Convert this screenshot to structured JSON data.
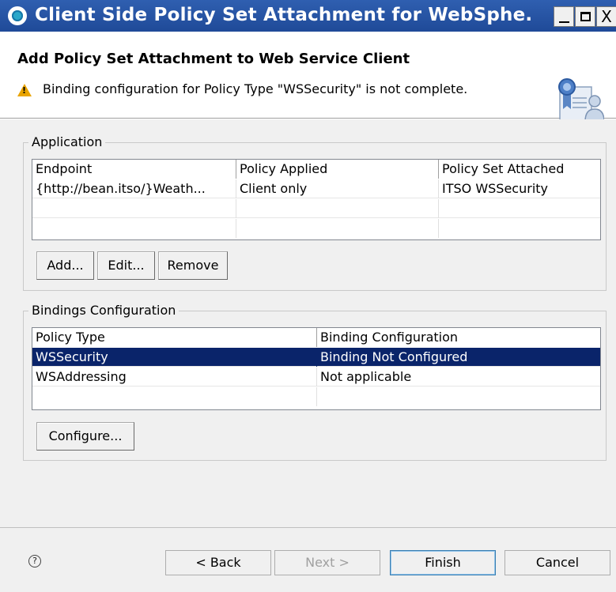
{
  "window": {
    "title": "Client Side Policy Set Attachment for WebSphe...",
    "title_icon": "websphere-globe-icon",
    "minimize_label": "_",
    "maximize_label": "",
    "close_label": "X"
  },
  "header": {
    "title": "Add Policy Set Attachment to Web Service Client",
    "message": "Binding configuration for Policy Type \"WSSecurity\" is not complete.",
    "warning_icon": "warning-triangle-icon",
    "banner_icon": "certificate-user-icon"
  },
  "application": {
    "group_label": "Application",
    "columns": [
      "Endpoint",
      "Policy Applied",
      "Policy Set Attached"
    ],
    "rows": [
      [
        "{http://bean.itso/}Weath...",
        "Client only",
        "ITSO WSSecurity"
      ]
    ],
    "buttons": {
      "add": "Add...",
      "edit": "Edit...",
      "remove": "Remove"
    }
  },
  "bindings": {
    "group_label": "Bindings Configuration",
    "columns": [
      "Policy Type",
      "Binding Configuration"
    ],
    "rows": [
      [
        "WSSecurity",
        "Binding Not Configured"
      ],
      [
        "WSAddressing",
        "Not applicable"
      ]
    ],
    "selected_row": 0,
    "configure_button": "Configure..."
  },
  "footer": {
    "help_icon": "help-icon",
    "help_glyph": "?",
    "back": "< Back",
    "next": "Next >",
    "finish": "Finish",
    "cancel": "Cancel"
  },
  "colors": {
    "titlebar": "#2f5fb0",
    "selection": "#0a246a",
    "warning": "#e9a400"
  }
}
